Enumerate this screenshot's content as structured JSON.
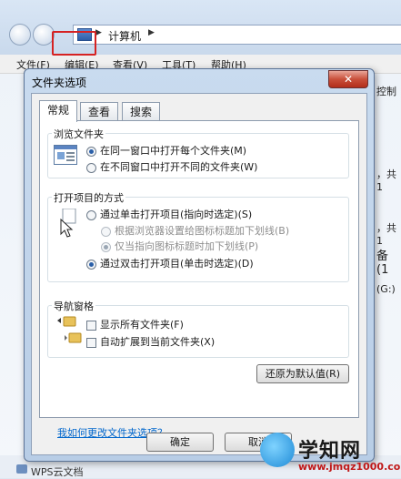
{
  "explorer": {
    "address": "计算机",
    "menu": [
      "文件(F)",
      "编辑(E)",
      "查看(V)",
      "工具(T)",
      "帮助(H)"
    ],
    "side_fragments": [
      "控制",
      "，共 1",
      "，共 1",
      "备 (1",
      "(G:)"
    ],
    "taskbar_item": "WPS云文档"
  },
  "dialog": {
    "title": "文件夹选项",
    "close_label": "✕",
    "tabs": [
      "常规",
      "查看",
      "搜索"
    ],
    "browse_group": {
      "title": "浏览文件夹",
      "options": [
        "在同一窗口中打开每个文件夹(M)",
        "在不同窗口中打开不同的文件夹(W)"
      ],
      "selected": 0
    },
    "click_group": {
      "title": "打开项目的方式",
      "option_single": "通过单击打开项目(指向时选定)(S)",
      "sub_options": [
        "根据浏览器设置给图标标题加下划线(B)",
        "仅当指向图标标题时加下划线(P)"
      ],
      "option_double": "通过双击打开项目(单击时选定)(D)",
      "selected": "double"
    },
    "nav_group": {
      "title": "导航窗格",
      "checks": [
        "显示所有文件夹(F)",
        "自动扩展到当前文件夹(X)"
      ]
    },
    "restore_button": "还原为默认值(R)",
    "help_link": "我如何更改文件夹选项？",
    "ok_button": "确定",
    "cancel_button": "取消"
  },
  "watermark": {
    "text": "学知网",
    "url": "www.jmqz1000.com"
  },
  "colors": {
    "highlight": "#d62222",
    "link": "#0066cc",
    "close": "#c9503b"
  }
}
